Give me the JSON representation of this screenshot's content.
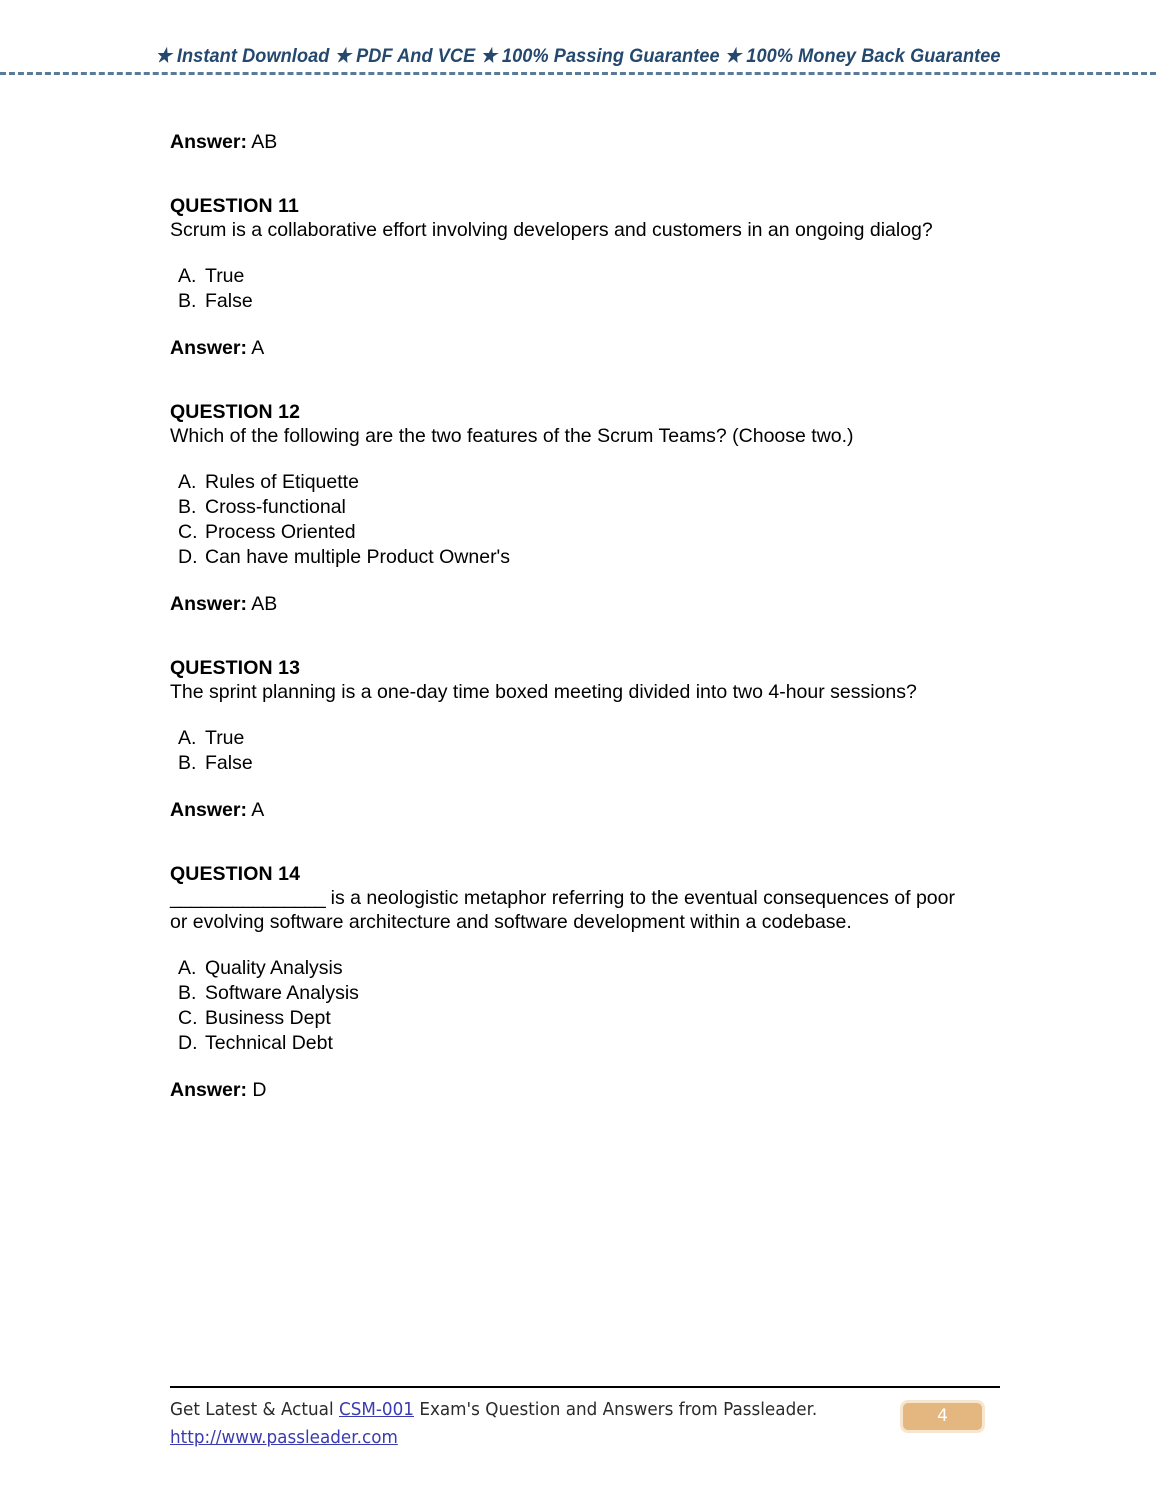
{
  "header": {
    "star_glyph": "★",
    "segments": [
      "Instant Download",
      "PDF And VCE",
      "100% Passing Guarantee",
      "100% Money Back Guarantee"
    ],
    "full_text": "★ Instant Download ★ PDF And VCE ★ 100% Passing Guarantee ★ 100% Money Back Guarantee",
    "text_color": "#24486e",
    "rule_color": "#5a7a9a"
  },
  "document": {
    "top_answer": {
      "label": "Answer:",
      "value": "AB"
    },
    "questions": [
      {
        "heading": "QUESTION 11",
        "text": "Scrum is a collaborative effort involving developers and customers in an ongoing dialog?",
        "options": [
          {
            "letter": "A.",
            "text": "True"
          },
          {
            "letter": "B.",
            "text": "False"
          }
        ],
        "answer_label": "Answer:",
        "answer_value": "A"
      },
      {
        "heading": "QUESTION 12",
        "text": "Which of the following are the two features of the Scrum Teams? (Choose two.)",
        "options": [
          {
            "letter": "A.",
            "text": "Rules of Etiquette"
          },
          {
            "letter": "B.",
            "text": "Cross-functional"
          },
          {
            "letter": "C.",
            "text": "Process Oriented"
          },
          {
            "letter": "D.",
            "text": "Can have multiple Product Owner's"
          }
        ],
        "answer_label": "Answer:",
        "answer_value": "AB"
      },
      {
        "heading": "QUESTION 13",
        "text": "The sprint planning is a one-day time boxed meeting divided into two 4-hour sessions?",
        "options": [
          {
            "letter": "A.",
            "text": "True"
          },
          {
            "letter": "B.",
            "text": "False"
          }
        ],
        "answer_label": "Answer:",
        "answer_value": "A"
      },
      {
        "heading": "QUESTION 14",
        "blank": "_______________",
        "text": " is a neologistic metaphor referring to the eventual consequences of poor or evolving software architecture and software development within a codebase.",
        "options": [
          {
            "letter": "A.",
            "text": "Quality Analysis"
          },
          {
            "letter": "B.",
            "text": "Software Analysis"
          },
          {
            "letter": "C.",
            "text": "Business Dept"
          },
          {
            "letter": "D.",
            "text": "Technical Debt"
          }
        ],
        "answer_label": "Answer:",
        "answer_value": "D"
      }
    ]
  },
  "footer": {
    "prefix": "Get Latest & Actual ",
    "exam_code": "CSM-001",
    "suffix": " Exam's Question and Answers from Passleader.",
    "url": "http://www.passleader.com",
    "page_number": "4",
    "link_color": "#3b3bb0",
    "badge_fill": "#e3b77f",
    "badge_border": "#f6e6cd"
  }
}
